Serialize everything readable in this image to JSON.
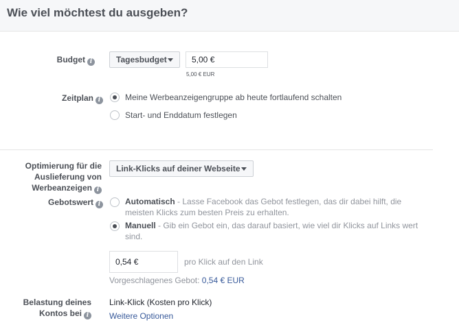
{
  "header": {
    "title": "Wie viel möchtest du ausgeben?"
  },
  "budget": {
    "label": "Budget",
    "type_label": "Tagesbudget",
    "value": "5,00 €",
    "hint": "5,00 € EUR"
  },
  "schedule": {
    "label": "Zeitplan",
    "option1": "Meine Werbeanzeigengruppe ab heute fortlaufend schalten",
    "option2": "Start- und Enddatum festlegen"
  },
  "optimization": {
    "label_line1": "Optimierung für die",
    "label_line2": "Auslieferung von",
    "label_line3": "Werbeanzeigen",
    "selected": "Link-Klicks auf deiner Webseite"
  },
  "bid": {
    "label": "Gebotswert",
    "auto_title": "Automatisch",
    "auto_desc_line1": " - Lasse Facebook das Gebot festlegen, das dir dabei hilft, die",
    "auto_desc_line2": "meisten Klicks zum besten Preis zu erhalten.",
    "manual_title": "Manuell",
    "manual_desc_line1": " - Gib ein Gebot ein, das darauf basiert, wie viel dir Klicks auf Links wert",
    "manual_desc_line2": "sind.",
    "value": "0,54 €",
    "unit": "pro Klick auf den Link",
    "suggested_label": "Vorgeschlagenes Gebot: ",
    "suggested_value": "0,54 € EUR"
  },
  "charging": {
    "label_line1": "Belastung deines",
    "label_line2": "Kontos bei",
    "value": "Link-Klick (Kosten pro Klick)",
    "more_options": "Weitere Optionen"
  }
}
